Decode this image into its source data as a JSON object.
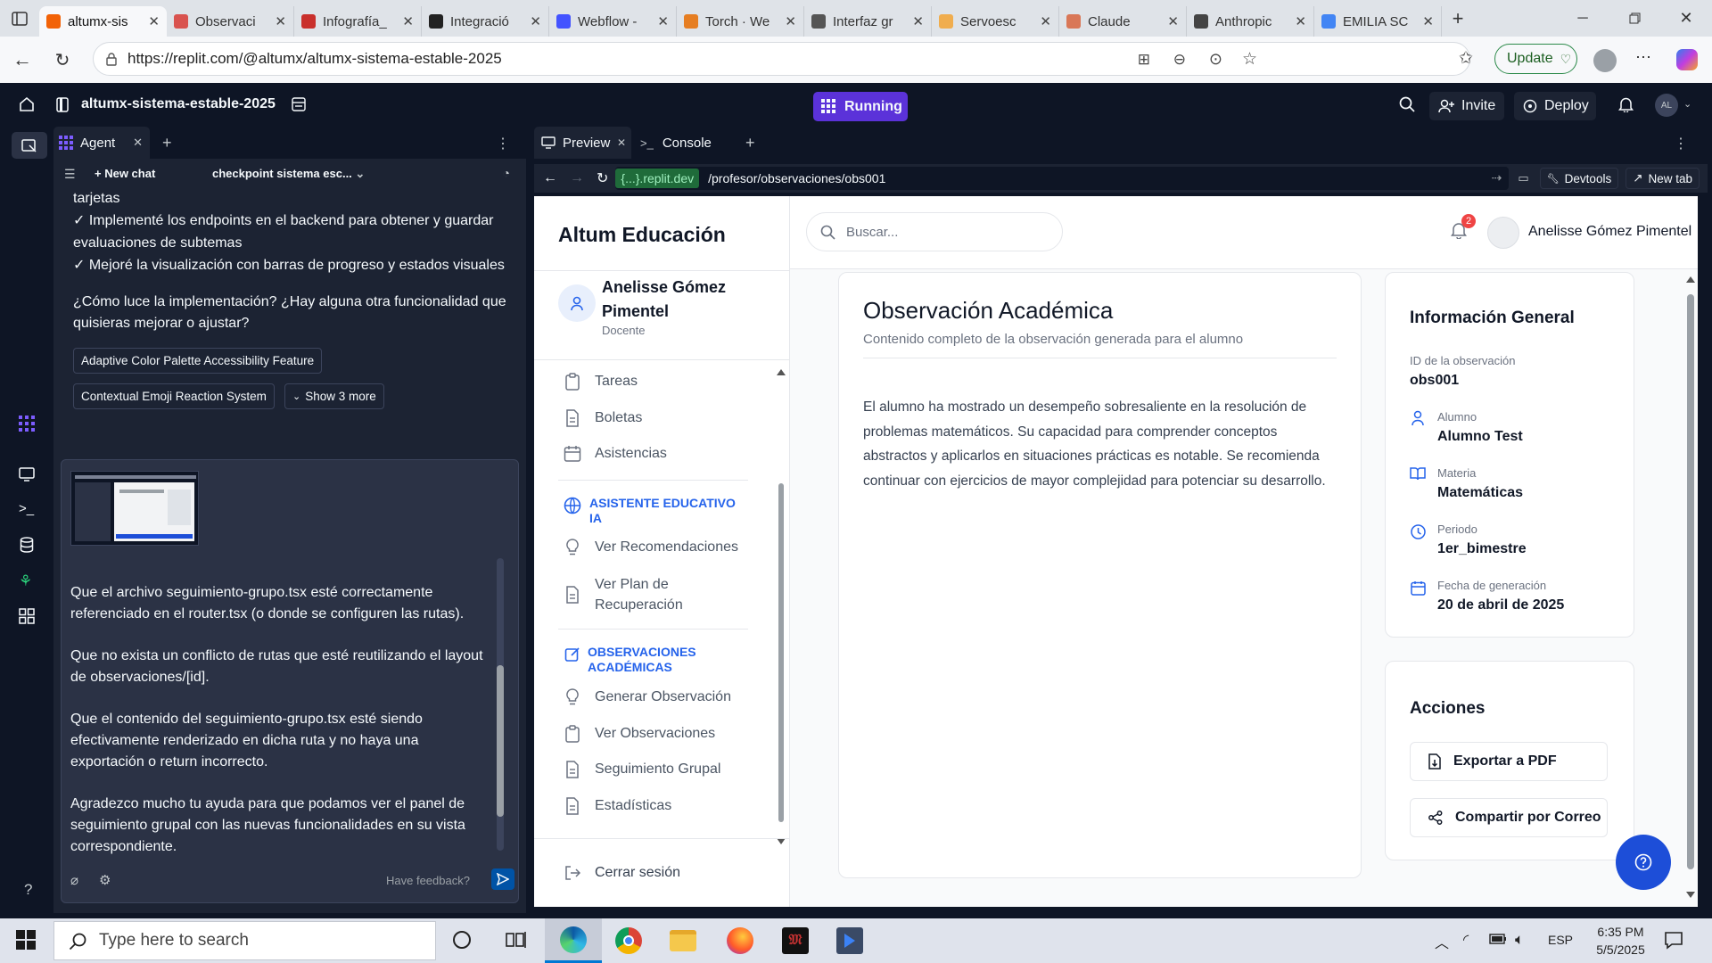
{
  "browser": {
    "tabs": [
      {
        "title": "altumx-sis",
        "active": true,
        "color": "#f26207"
      },
      {
        "title": "Observaci",
        "color": "#d9534f"
      },
      {
        "title": "Infografía_",
        "color": "#c9302c"
      },
      {
        "title": "Integració",
        "color": "#222222"
      },
      {
        "title": "Webflow -",
        "color": "#4353ff"
      },
      {
        "title": "Torch · We",
        "color": "#e67e22"
      },
      {
        "title": "Interfaz gr",
        "color": "#555555"
      },
      {
        "title": "Servoesc",
        "color": "#f0ad4e"
      },
      {
        "title": "Claude",
        "color": "#d97757"
      },
      {
        "title": "Anthropic",
        "color": "#444444"
      },
      {
        "title": "EMILIA SC",
        "color": "#4285f4"
      }
    ],
    "url": "https://replit.com/@altumx/altumx-sistema-estable-2025",
    "update_label": "Update"
  },
  "replit": {
    "repl_name": "altumx-sistema-estable-2025",
    "status": "Running",
    "invite_label": "Invite",
    "deploy_label": "Deploy",
    "avatar_initials": "AL",
    "help_label": "?"
  },
  "agent": {
    "tab_label": "Agent",
    "new_chat": "New chat",
    "checkpoint": "checkpoint sistema esc...",
    "lines": [
      "tarjetas",
      "✓ Implementé los endpoints en el backend para obtener y guardar",
      "evaluaciones de subtemas",
      "✓ Mejoré la visualización con barras de progreso y estados visuales"
    ],
    "question_1": "¿Cómo luce la implementación? ¿Hay alguna otra funcionalidad que",
    "question_2": "quisieras mejorar o ajustar?",
    "chips": [
      "Adaptive Color Palette Accessibility Feature",
      "Contextual Emoji Reaction System"
    ],
    "show_more": "Show 3 more",
    "composer": {
      "p1": [
        "Que el archivo seguimiento-grupo.tsx esté correctamente",
        "referenciado en el router.tsx (o donde se configuren las rutas)."
      ],
      "p2": [
        "Que no exista un conflicto de rutas que esté reutilizando el layout",
        "de observaciones/[id]."
      ],
      "p3": [
        "Que el contenido del seguimiento-grupo.tsx esté siendo",
        "efectivamente renderizado en dicha ruta y no haya una",
        "exportación o return incorrecto."
      ],
      "p4": [
        "Agradezco mucho tu ayuda para que podamos ver el panel de",
        "seguimiento grupal con las nuevas funcionalidades en su vista",
        "correspondiente."
      ],
      "feedback": "Have feedback?"
    }
  },
  "preview": {
    "tab_preview": "Preview",
    "tab_console": "Console",
    "domain": "{...}.replit.dev",
    "path": "/profesor/observaciones/obs001",
    "devtools": "Devtools",
    "new_tab": "New tab"
  },
  "app": {
    "brand": "Altum Educación",
    "user_name_1": "Anelisse Gómez",
    "user_name_2": "Pimentel",
    "user_role": "Docente",
    "nav": {
      "tareas": "Tareas",
      "boletas": "Boletas",
      "asistencias": "Asistencias",
      "section_ai_1": "ASISTENTE EDUCATIVO",
      "section_ai_2": "IA",
      "ver_recomendaciones": "Ver Recomendaciones",
      "ver_plan_1": "Ver Plan de",
      "ver_plan_2": "Recuperación",
      "section_obs_1": "OBSERVACIONES",
      "section_obs_2": "ACADÉMICAS",
      "generar": "Generar Observación",
      "ver_obs": "Ver Observaciones",
      "seguimiento": "Seguimiento Grupal",
      "estadisticas": "Estadísticas",
      "logout": "Cerrar sesión"
    },
    "search_placeholder": "Buscar...",
    "notif_count": "2",
    "header_user": "Anelisse Gómez Pimentel",
    "obs": {
      "title": "Observación Académica",
      "subtitle": "Contenido completo de la observación generada para el alumno",
      "body_lines": [
        "El alumno ha mostrado un desempeño sobresaliente en la resolución de",
        "problemas matemáticos. Su capacidad para comprender conceptos",
        "abstractos y aplicarlos en situaciones prácticas es notable. Se recomienda",
        "continuar con ejercicios de mayor complejidad para potenciar su desarrollo."
      ]
    },
    "info": {
      "title": "Información General",
      "id_label": "ID de la observación",
      "id_value": "obs001",
      "alumno_label": "Alumno",
      "alumno_value": "Alumno Test",
      "materia_label": "Materia",
      "materia_value": "Matemáticas",
      "periodo_label": "Periodo",
      "periodo_value": "1er_bimestre",
      "fecha_label": "Fecha de generación",
      "fecha_value": "20 de abril de 2025"
    },
    "actions": {
      "title": "Acciones",
      "pdf": "Exportar a PDF",
      "email": "Compartir por Correo"
    }
  },
  "taskbar": {
    "search_placeholder": "Type here to search",
    "language": "ESP",
    "time": "6:35 PM",
    "date": "5/5/2025"
  }
}
